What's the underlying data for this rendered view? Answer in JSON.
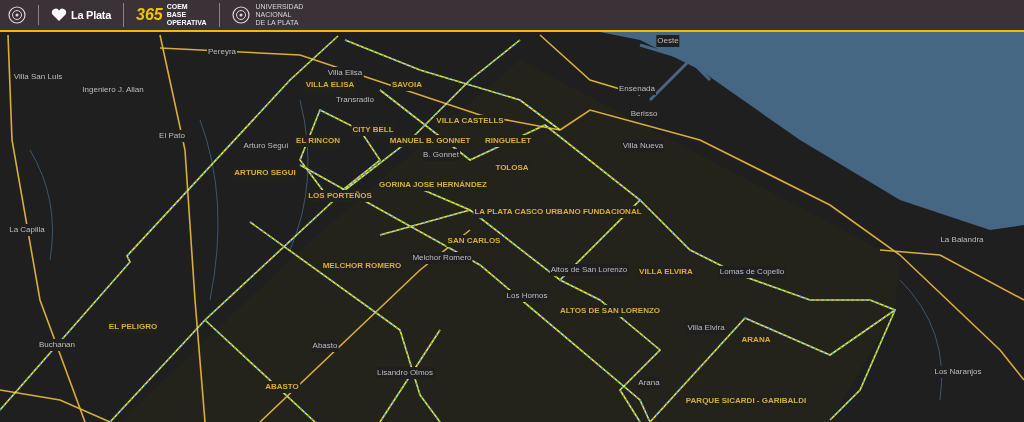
{
  "header": {
    "brand": "La Plata",
    "event_number": "365",
    "event_lines": [
      "COEM",
      "BASE",
      "OPERATIVA"
    ],
    "university_lines": [
      "UNIVERSIDAD",
      "NACIONAL",
      "DE LA PLATA"
    ]
  },
  "map": {
    "districts": [
      {
        "name": "VILLA ELISA"
      },
      {
        "name": "SAVOIA"
      },
      {
        "name": "VILLA CASTELLS"
      },
      {
        "name": "CITY BELL"
      },
      {
        "name": "EL RINCON"
      },
      {
        "name": "MANUEL B. GONNET"
      },
      {
        "name": "RINGUELET"
      },
      {
        "name": "TOLOSA"
      },
      {
        "name": "ARTURO SEGUI"
      },
      {
        "name": "GORINA"
      },
      {
        "name": "JOSE HERNÁNDEZ"
      },
      {
        "name": "LOS PORTEÑOS"
      },
      {
        "name": "LA PLATA CASCO URBANO FUNDACIONAL"
      },
      {
        "name": "SAN CARLOS"
      },
      {
        "name": "MELCHOR ROMERO"
      },
      {
        "name": "VILLA ELVIRA"
      },
      {
        "name": "ALTOS DE SAN LORENZO"
      },
      {
        "name": "EL PELIGRO"
      },
      {
        "name": "ARANA"
      },
      {
        "name": "ABASTO"
      },
      {
        "name": "PARQUE SICARDI - GARIBALDI"
      }
    ],
    "places": [
      {
        "name": "Oeste"
      },
      {
        "name": "Villa San Luis"
      },
      {
        "name": "Ingeniero J. Allan"
      },
      {
        "name": "El Pato"
      },
      {
        "name": "Arturo Seguí"
      },
      {
        "name": "Villa Elisa"
      },
      {
        "name": "Transradio"
      },
      {
        "name": "B. Gonnet"
      },
      {
        "name": "Ensenada"
      },
      {
        "name": "Berisso"
      },
      {
        "name": "Villa Nueva"
      },
      {
        "name": "La Capilla"
      },
      {
        "name": "Melchor Romero"
      },
      {
        "name": "Los Hornos"
      },
      {
        "name": "Altos de San Lorenzo"
      },
      {
        "name": "Lomas de Copello"
      },
      {
        "name": "Villa Elvira"
      },
      {
        "name": "La Balandra"
      },
      {
        "name": "Buchanan"
      },
      {
        "name": "Abasto"
      },
      {
        "name": "Lisandro Olmos"
      },
      {
        "name": "Arana"
      },
      {
        "name": "Los Naranjos"
      },
      {
        "name": "Pereyra"
      }
    ]
  }
}
